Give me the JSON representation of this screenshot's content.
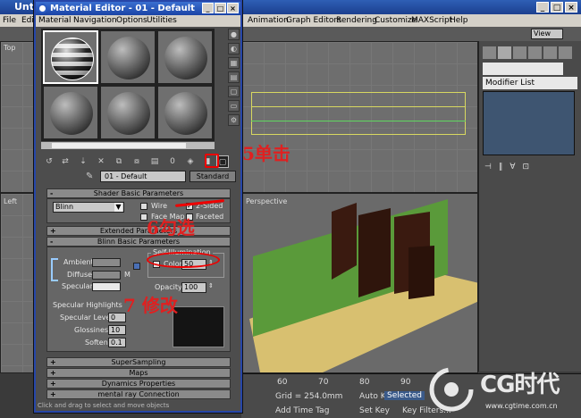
{
  "max_window": {
    "title": "Untit",
    "menu": [
      "File",
      "Edit",
      "Animation",
      "Graph Editors",
      "Rendering",
      "Customize",
      "MAXScript",
      "Help"
    ],
    "viewport_labels": [
      "Top",
      "Left",
      "Perspective"
    ],
    "view_dropdown": "View"
  },
  "command_panel": {
    "modifier_list": "Modifier List"
  },
  "timeline": {
    "ticks": [
      "60",
      "70",
      "80",
      "90"
    ],
    "grid": "Grid = 254.0mm",
    "auto_key": "Auto Key",
    "selected": "Selected",
    "set_key": "Set Key",
    "key_filters": "Key Filters...",
    "add_time_tag": "Add Time Tag",
    "status": "Click and drag to select and move objects"
  },
  "material_editor": {
    "title": "Material Editor - 01 - Default",
    "menu": [
      "Material",
      "Navigation",
      "Options",
      "Utilities"
    ],
    "material_name": "01 - Default",
    "type_button": "Standard",
    "zero_label": "0",
    "rollouts": {
      "shader_basic": "Shader Basic Parameters",
      "extended": "Extended Parameters",
      "blinn_basic": "Blinn Basic Parameters",
      "supersampling": "SuperSampling",
      "maps": "Maps",
      "dynamics": "Dynamics Properties",
      "mental_ray": "mental ray Connection"
    },
    "shader": {
      "type": "Blinn",
      "wire": "Wire",
      "two_sided": "2-Sided",
      "face_map": "Face Map",
      "faceted": "Faceted",
      "two_sided_checked": true
    },
    "blinn": {
      "ambient": "Ambient:",
      "diffuse": "Diffuse:",
      "specular": "Specular:",
      "lock_letter": "M",
      "self_illum_group": "Self-Illumination",
      "color_label": "Color",
      "color_value": "50",
      "opacity_label": "Opacity:",
      "opacity_value": "100",
      "spec_group": "Specular Highlights",
      "spec_level_label": "Specular Level:",
      "spec_level_value": "0",
      "glossiness_label": "Glossiness:",
      "glossiness_value": "10",
      "soften_label": "Soften:",
      "soften_value": "0.1"
    }
  },
  "annotations": {
    "step5": "5单击",
    "step6": "6勾选",
    "step7": "7 修改"
  },
  "watermark": {
    "logo": "CG时代",
    "url": "www.cgtime.com.cn"
  },
  "colors": {
    "annotation_red": "#e02020",
    "title_blue": "#2a5ac0",
    "green_plane": "#5a9a3a",
    "yellow_floor": "#d8c070",
    "dark_panels": "#3a1a10"
  }
}
